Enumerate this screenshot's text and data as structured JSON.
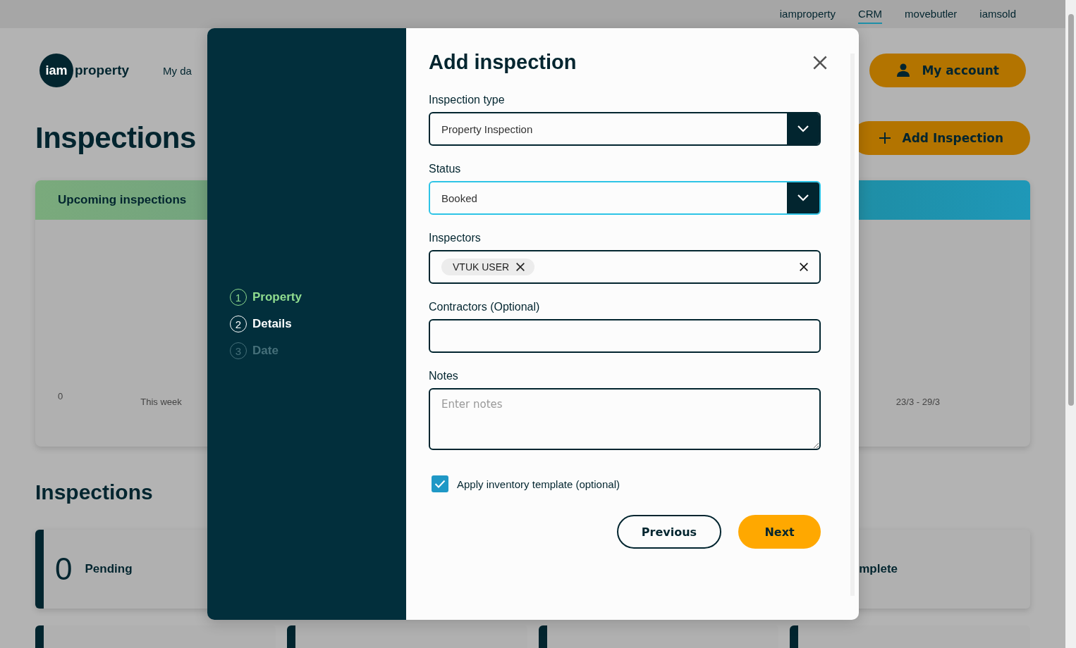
{
  "top_links": [
    {
      "label": "iamproperty",
      "selected": false
    },
    {
      "label": "CRM",
      "selected": true
    },
    {
      "label": "movebutler",
      "selected": false
    },
    {
      "label": "iamsold"
    }
  ],
  "header": {
    "logo_left": "iam",
    "logo_right": "property",
    "nav": "My da",
    "account_button": "My account"
  },
  "page_title": "Inspections",
  "add_button": "Add Inspection",
  "chart_card": {
    "title": "Upcoming inspections",
    "y_tick": "0",
    "x_left": "This week",
    "x_right": "23/3 - 29/3"
  },
  "section_title": "Inspections",
  "stat_cards": [
    {
      "count": "0",
      "label": "Pending"
    },
    {
      "label": "mplete"
    }
  ],
  "modal": {
    "title": "Add inspection",
    "steps": [
      {
        "number": "1",
        "label": "Property",
        "completed": true,
        "selected": false
      },
      {
        "number": "2",
        "label": "Details",
        "completed": false,
        "selected": true
      },
      {
        "number": "3",
        "label": "Date",
        "completed": false,
        "selected": false
      }
    ],
    "fields": [
      {
        "kind": "select",
        "label": "Inspection type",
        "value": "Property Inspection",
        "focused": false
      },
      {
        "kind": "select",
        "label": "Status",
        "value": "Booked",
        "focused": true
      },
      {
        "kind": "tags",
        "label": "Inspectors",
        "tags": [
          "VTUK USER"
        ]
      },
      {
        "kind": "text",
        "label": "Contractors (Optional)"
      },
      {
        "kind": "textarea",
        "label": "Notes",
        "placeholder": "Enter notes"
      }
    ],
    "checkbox": {
      "label": "Apply inventory template (optional)",
      "checked": true
    },
    "previous_button": "Previous",
    "next_button": "Next"
  }
}
